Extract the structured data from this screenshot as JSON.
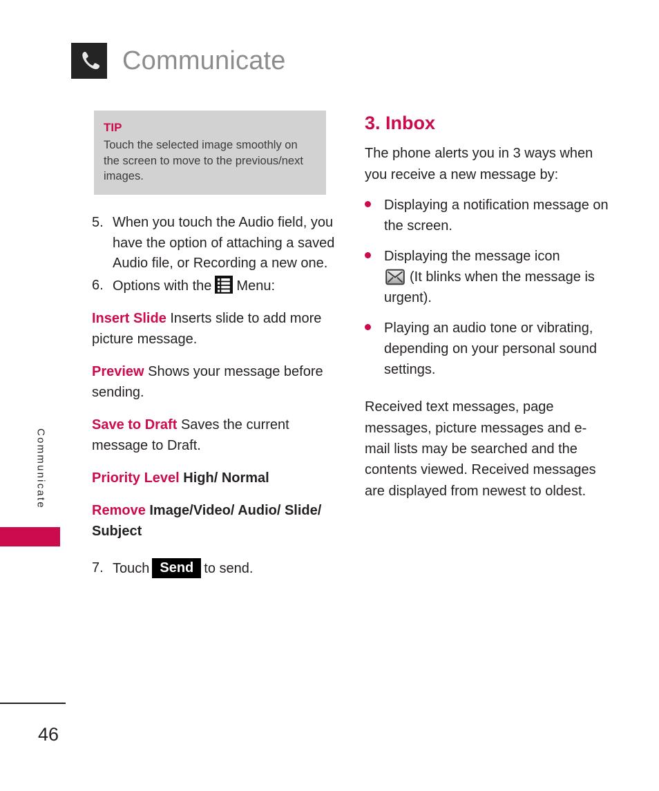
{
  "header": {
    "icon": "phone-handset-icon",
    "title": "Communicate"
  },
  "side_tab": {
    "label": "Communicate",
    "color": "#cc0a4e"
  },
  "colors": {
    "accent": "#cc0a4e",
    "tip_background": "#d2d2d2",
    "header_title": "#8c8c8c",
    "body_text": "#231f20"
  },
  "left_column": {
    "tip": {
      "title": "TIP",
      "body": "Touch the selected image smoothly on the screen to move to the previous/next images."
    },
    "steps": [
      {
        "number": "5.",
        "text": "When you touch the Audio field, you have the option of attaching a saved Audio file, or Recording a new one."
      },
      {
        "number": "6.",
        "text_before": "Options with the",
        "icon": "list-menu-icon",
        "text_after": "Menu:"
      },
      {
        "number": "7.",
        "text_before": "Touch",
        "chip": "Send",
        "text_after": "to send."
      }
    ],
    "options": [
      {
        "term": "Insert Slide",
        "desc": "Inserts slide to add more picture message.",
        "desc_bold": false
      },
      {
        "term": "Preview",
        "desc": "Shows your message before sending.",
        "desc_bold": false
      },
      {
        "term": "Save to Draft",
        "desc": "Saves the current message to Draft.",
        "desc_bold": false
      },
      {
        "term": "Priority Level",
        "desc": "High/ Normal",
        "desc_bold": true
      },
      {
        "term": "Remove",
        "desc": "Image/Video/ Audio/ Slide/ Subject",
        "desc_bold": true
      }
    ]
  },
  "right_column": {
    "section_title": "3. Inbox",
    "intro": "The phone alerts you in 3 ways when you receive a new message by:",
    "bullets": [
      {
        "text": "Displaying a notification message on the screen.",
        "icon": null
      },
      {
        "text_before": "Displaying the message icon",
        "icon": "envelope-message-icon",
        "text_after": "(It blinks when the message is urgent)."
      },
      {
        "text": "Playing an audio tone or vibrating, depending on your personal sound settings.",
        "icon": null
      }
    ],
    "closing": "Received text messages, page messages, picture messages and e-mail lists may be searched and the contents viewed. Received messages are displayed from newest to oldest."
  },
  "footer": {
    "page_number": "46"
  }
}
